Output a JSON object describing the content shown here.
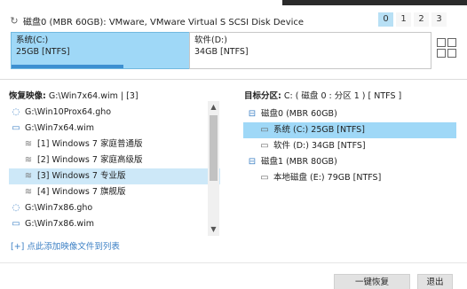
{
  "disk": {
    "title": "磁盘0 (MBR 60GB): VMware, VMware Virtual S SCSI Disk Device",
    "tabs": [
      "0",
      "1",
      "2",
      "3"
    ],
    "active_tab": 0,
    "partitions": [
      {
        "name": "系统(C:)",
        "size": "25GB [NTFS]",
        "selected": true,
        "used_fraction": 0.63
      },
      {
        "name": "软件(D:)",
        "size": "34GB [NTFS]",
        "selected": false,
        "used_fraction": 0
      }
    ]
  },
  "left": {
    "label": "恢复映像:",
    "value": "G:\\Win7x64.wim | [3]",
    "items": [
      {
        "text": "G:\\Win10Prox64.gho",
        "icon": "ghost-image-icon",
        "level": 0,
        "selected": false
      },
      {
        "text": "G:\\Win7x64.wim",
        "icon": "monitor-icon",
        "level": 0,
        "selected": false
      },
      {
        "text": "[1] Windows 7 家庭普通版",
        "icon": "layers-icon",
        "level": 1,
        "selected": false
      },
      {
        "text": "[2] Windows 7 家庭高级版",
        "icon": "layers-icon",
        "level": 1,
        "selected": false
      },
      {
        "text": "[3] Windows 7 专业版",
        "icon": "layers-icon",
        "level": 1,
        "selected": true
      },
      {
        "text": "[4] Windows 7 旗舰版",
        "icon": "layers-icon",
        "level": 1,
        "selected": false
      },
      {
        "text": "G:\\Win7x86.gho",
        "icon": "ghost-image-icon",
        "level": 0,
        "selected": false
      },
      {
        "text": "G:\\Win7x86.wim",
        "icon": "monitor-icon",
        "level": 0,
        "selected": false
      }
    ],
    "add_link": "[+] 点此添加映像文件到列表"
  },
  "right": {
    "label": "目标分区:",
    "value": "C: ( 磁盘 0 : 分区 1 ) [ NTFS ]",
    "tree": [
      {
        "text": "磁盘0 (MBR 60GB)",
        "level": 0,
        "selected": false
      },
      {
        "text": "系统 (C:) 25GB [NTFS]",
        "level": 1,
        "selected": true
      },
      {
        "text": "软件 (D:) 34GB [NTFS]",
        "level": 1,
        "selected": false
      },
      {
        "text": "磁盘1 (MBR 80GB)",
        "level": 0,
        "selected": false
      },
      {
        "text": "本地磁盘 (E:) 79GB [NTFS]",
        "level": 1,
        "selected": false
      }
    ]
  },
  "buttons": {
    "restore": "一键恢复",
    "exit": "退出"
  },
  "icons": {
    "ghost-image-icon": "◌",
    "monitor-icon": "▭",
    "layers-icon": "≋",
    "disk-icon": "⊟",
    "partition-icon": "▭",
    "refresh-icon": "↻"
  }
}
